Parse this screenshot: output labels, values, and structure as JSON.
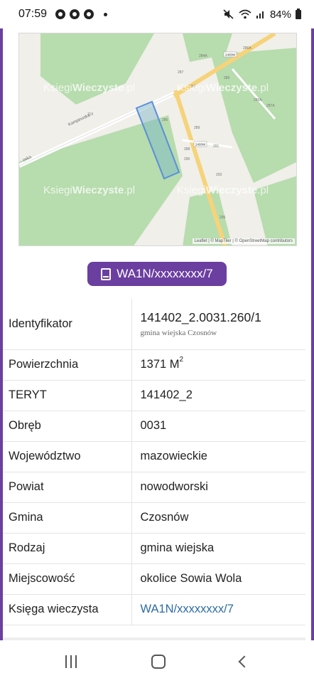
{
  "status_bar": {
    "time": "07:59",
    "battery": "84%",
    "icons": [
      "chrome-icon",
      "chrome-icon",
      "chrome-icon",
      "notification-dot-icon",
      "mute-icon",
      "wifi-icon",
      "signal-icon",
      "battery-icon"
    ]
  },
  "map": {
    "watermark_prefix": "Ksiegi",
    "watermark_brand": "Wieczyste",
    "watermark_suffix": ".pl",
    "road_label": "Kampinoska",
    "road_label_short": "oska",
    "house_numbers": [
      "119",
      "286",
      "288",
      "290",
      "291",
      "293",
      "295",
      "297",
      "285",
      "287",
      "289",
      "284A",
      "286A",
      "287A",
      "285A"
    ],
    "road_sign_1": "2400W",
    "road_sign_2": "2400W",
    "attribution": "Leaflet | © MapTiler | © OpenStreetMap contributors",
    "colors": {
      "forest": "#b7dcae",
      "field": "#f0efe9",
      "road": "#ffffff",
      "main_road": "#f6d37a",
      "parcel": "#5b8fd9"
    }
  },
  "kw_button": {
    "label": "WA1N/xxxxxxxx/7",
    "icon": "book-icon"
  },
  "table": {
    "rows": [
      {
        "label": "Identyfikator",
        "value": "141402_2.0031.260/1",
        "sub": "gmina wiejska Czosnów"
      },
      {
        "label": "Powierzchnia",
        "value": "1371 M",
        "sup": "2"
      },
      {
        "label": "TERYT",
        "value": "141402_2"
      },
      {
        "label": "Obręb",
        "value": "0031"
      },
      {
        "label": "Województwo",
        "value": "mazowieckie"
      },
      {
        "label": "Powiat",
        "value": "nowodworski"
      },
      {
        "label": "Gmina",
        "value": "Czosnów"
      },
      {
        "label": "Rodzaj",
        "value": "gmina wiejska"
      },
      {
        "label": "Miejscowość",
        "value": "okolice Sowia Wola"
      },
      {
        "label": "Księga wieczysta",
        "value": "WA1N/xxxxxxxx/7"
      }
    ]
  },
  "colors": {
    "accent": "#6b3fa0",
    "link": "#2b6ca3"
  }
}
